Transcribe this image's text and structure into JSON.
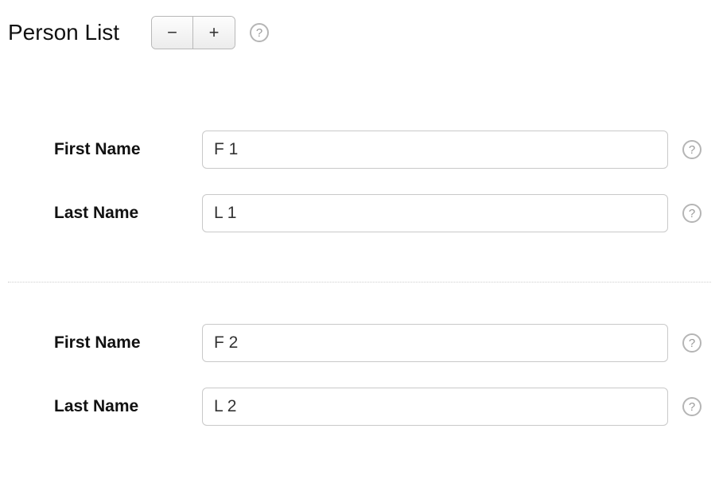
{
  "header": {
    "title": "Person List",
    "remove_label": "−",
    "add_label": "+",
    "help_glyph": "?"
  },
  "labels": {
    "first_name": "First Name",
    "last_name": "Last Name"
  },
  "persons": [
    {
      "first_name": "F 1",
      "last_name": "L 1"
    },
    {
      "first_name": "F 2",
      "last_name": "L 2"
    }
  ]
}
